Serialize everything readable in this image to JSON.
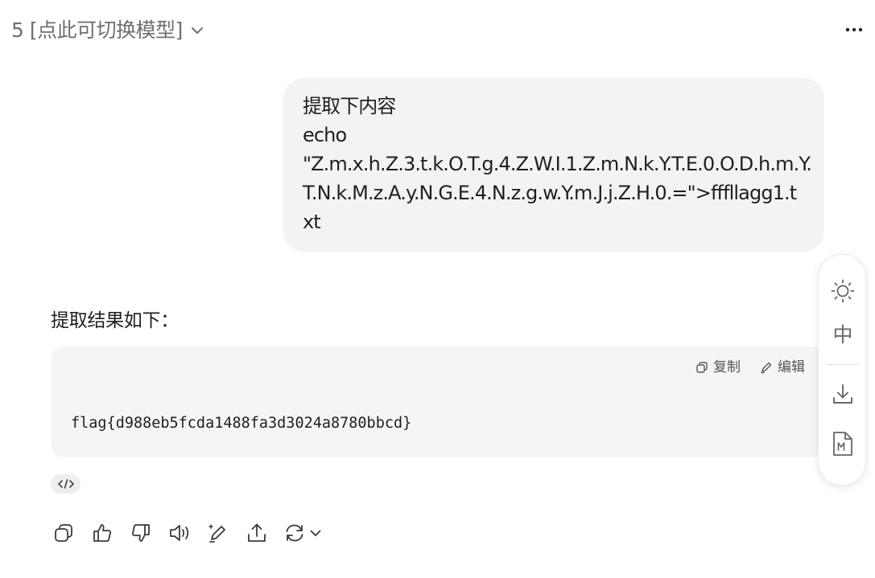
{
  "header": {
    "model_label": "5 [点此可切换模型]",
    "model_dropdown_icon": "chevron-down-icon",
    "more_icon": "more-horizontal-icon"
  },
  "user_message": {
    "lines": [
      "提取下内容",
      "echo",
      "\"Z.m.x.h.Z.3.t.k.O.T.g.4.Z.W.I.1.Z.m.N.k.Y.T.E.0.O.D.h.m.Y.",
      "T.N.k.M.z.A.y.N.G.E.4.N.z.g.w.Y.m.J.j.Z.H.0.=\">fffllagg1.t",
      "xt"
    ]
  },
  "assistant_message": {
    "intro": "提取结果如下：",
    "code_block": {
      "copy_label": "复制",
      "edit_label": "编辑",
      "code": "flag{d988eb5fcda1488fa3d3024a8780bbcd}"
    },
    "source_icon": "code-icon"
  },
  "actions": {
    "icons": [
      "copy-icon",
      "thumbs-up-icon",
      "thumbs-down-icon",
      "speaker-icon",
      "edit-pen-icon",
      "share-icon",
      "regenerate-icon",
      "chevron-down-icon"
    ]
  },
  "side_toolbar": {
    "theme_icon": "sun-icon",
    "language_label": "中",
    "download_icon": "download-icon",
    "markdown_icon": "markdown-file-icon"
  },
  "colors": {
    "bubble_bg": "#f3f3f3",
    "code_bg": "#f5f5f5",
    "muted_text": "#6f6f6f",
    "icon_gray": "#555555"
  }
}
